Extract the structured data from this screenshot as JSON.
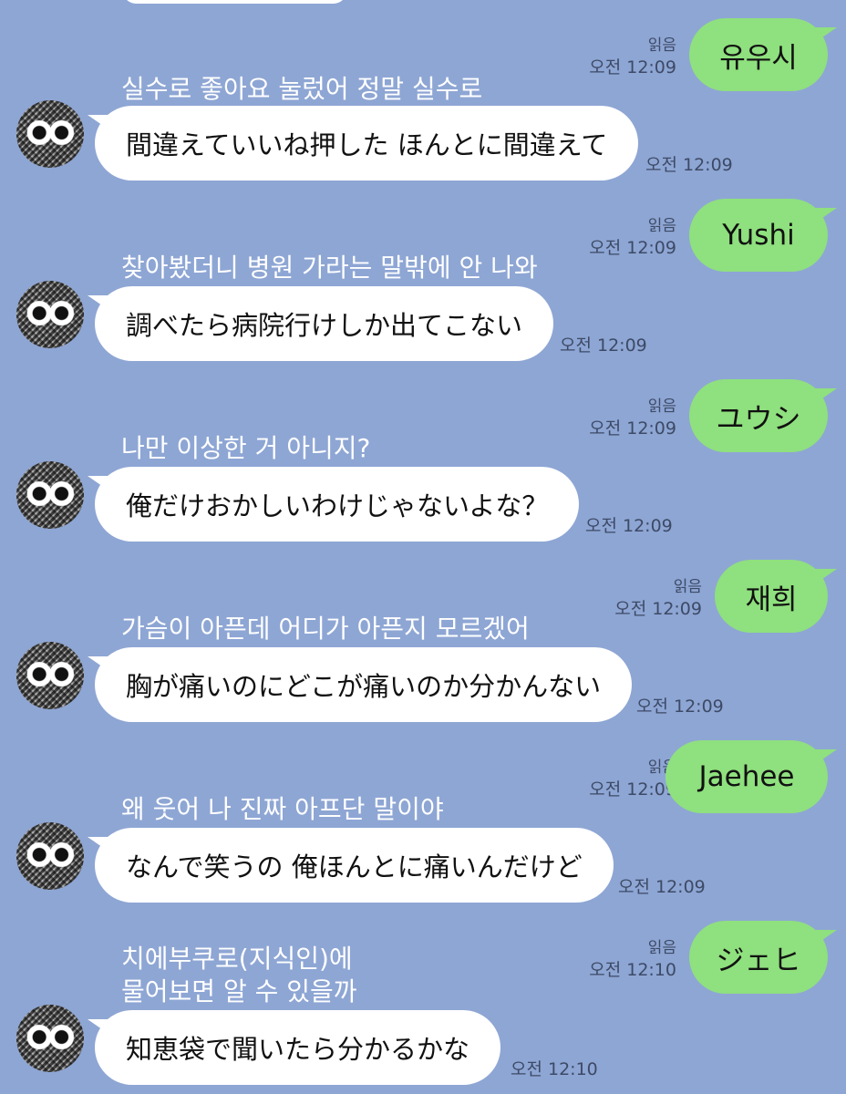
{
  "read_label": "읽음",
  "messages": [
    {
      "sent_text": "유우시",
      "sent_time": "오전 12:09",
      "label": "실수로 좋아요 눌렀어 정말 실수로",
      "recv_text": "間違えていいね押した ほんとに間違えて",
      "recv_time": "오전 12:09"
    },
    {
      "sent_text": "Yushi",
      "sent_time": "오전 12:09",
      "label": "찾아봤더니 병원 가라는 말밖에 안 나와",
      "recv_text": "調べたら病院行けしか出てこない",
      "recv_time": "오전 12:09"
    },
    {
      "sent_text": "ユウシ",
      "sent_time": "오전 12:09",
      "label": "나만 이상한 거 아니지?",
      "recv_text": "俺だけおかしいわけじゃないよな？",
      "recv_time": "오전 12:09"
    },
    {
      "sent_text": "재희",
      "sent_time": "오전 12:09",
      "label": "가슴이 아픈데 어디가 아픈지 모르겠어",
      "recv_text": "胸が痛いのにどこが痛いのか分かんない",
      "recv_time": "오전 12:09"
    },
    {
      "sent_text": "Jaehee",
      "sent_time": "오전 12:09",
      "label": "왜 웃어 나 진짜 아프단 말이야",
      "recv_text": "なんで笑うの 俺ほんとに痛いんだけど",
      "recv_time": "오전 12:09"
    },
    {
      "sent_text": "ジェヒ",
      "sent_time": "오전 12:10",
      "label": "치에부쿠로(지식인)에",
      "label2": "물어보면 알 수 있을까",
      "recv_text": "知恵袋で聞いたら分かるかな",
      "recv_time": "오전 12:10"
    }
  ]
}
